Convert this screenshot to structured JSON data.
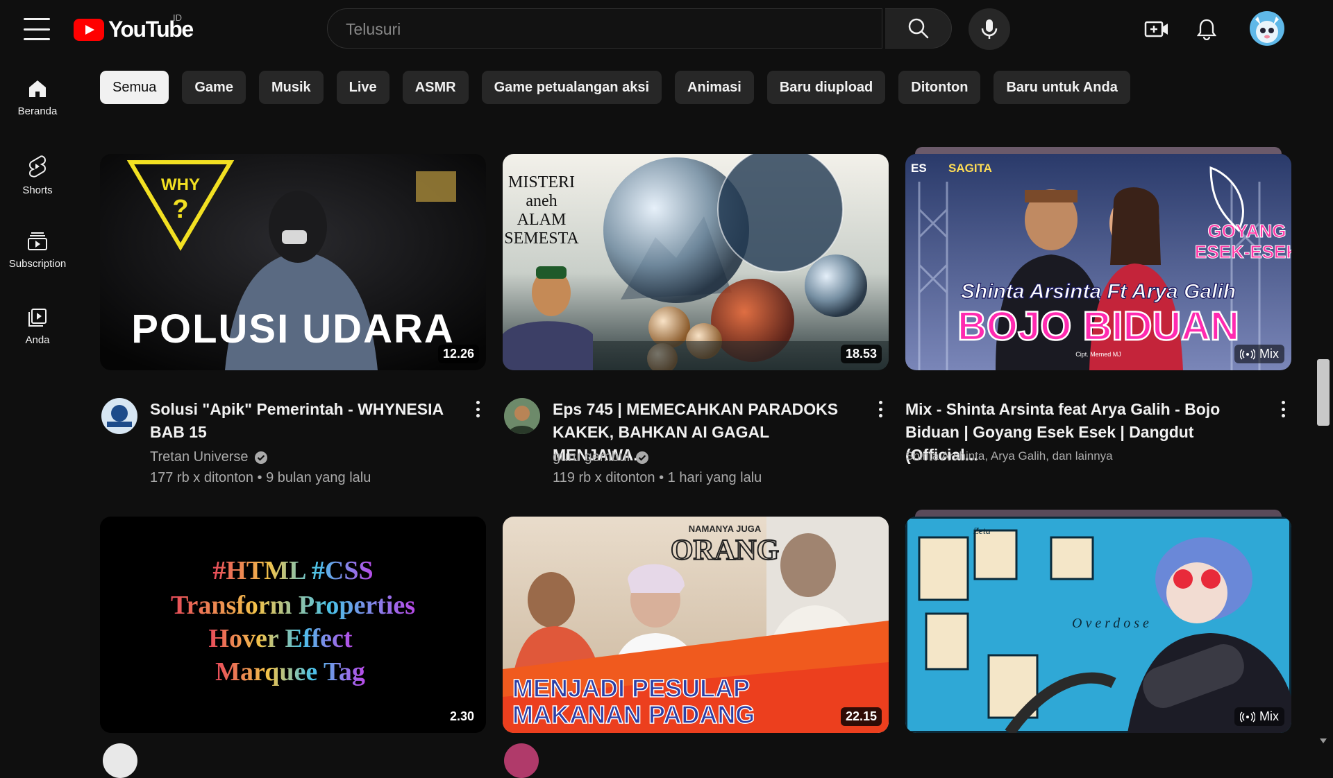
{
  "header": {
    "logo_text": "YouTube",
    "country_code": "ID",
    "search_placeholder": "Telusuri"
  },
  "sidebar": {
    "items": [
      {
        "label": "Beranda",
        "icon": "home-icon"
      },
      {
        "label": "Shorts",
        "icon": "shorts-icon"
      },
      {
        "label": "Subscription",
        "icon": "subscriptions-icon"
      },
      {
        "label": "Anda",
        "icon": "library-icon"
      }
    ]
  },
  "chips": [
    "Semua",
    "Game",
    "Musik",
    "Live",
    "ASMR",
    "Game petualangan aksi",
    "Animasi",
    "Baru diupload",
    "Ditonton",
    "Baru untuk Anda"
  ],
  "videos": [
    {
      "title": "Solusi \"Apik\" Pemerintah - WHYNESIA BAB 15",
      "channel": "Tretan Universe",
      "verified": true,
      "views": "177 rb x ditonton",
      "age": "9 bulan yang lalu",
      "duration": "12.26",
      "thumb_overlay": [
        "WHY",
        "?",
        "POLUSI UDARA"
      ]
    },
    {
      "title": "Eps 745 | MEMECAHKAN PARADOKS KAKEK, BAHKAN AI GAGAL MENJAWA...",
      "channel": "guru gembul",
      "verified": true,
      "views": "119 rb x ditonton",
      "age": "1 hari yang lalu",
      "duration": "18.53",
      "thumb_overlay": [
        "MISTERI",
        "aneh",
        "ALAM",
        "SEMESTA"
      ]
    },
    {
      "title": "Mix - Shinta Arsinta feat Arya Galih - Bojo Biduan | Goyang Esek Esek | Dangdut (Official...",
      "subtitle": "Shinta Arshinta, Arya Galih, dan lainnya",
      "badge": "Mix",
      "thumb_overlay": [
        "Shinta Arsinta Ft Arya Galih",
        "BOJO BIDUAN",
        "GOYANG",
        "ESEK-ESEK",
        "SAGITA",
        "ES",
        "Cipt. Memed MJ"
      ]
    },
    {
      "duration": "2.30",
      "thumb_overlay": [
        "#HTML #CSS",
        "Transform Properties",
        "Hover Effect",
        "Marquee Tag"
      ]
    },
    {
      "duration": "22.15",
      "thumb_overlay": [
        "NAMANYA JUGA",
        "ORANG",
        "MENJADI PESULAP",
        "MAKANAN PADANG"
      ]
    },
    {
      "badge": "Mix",
      "thumb_overlay": [
        "Overdose",
        "Zeta"
      ]
    }
  ],
  "colors": {
    "background": "#0f0f0f",
    "brand_red": "#ff0000",
    "chip_bg": "#272727",
    "chip_active_bg": "#f1f1f1",
    "secondary_text": "#aaaaaa"
  }
}
